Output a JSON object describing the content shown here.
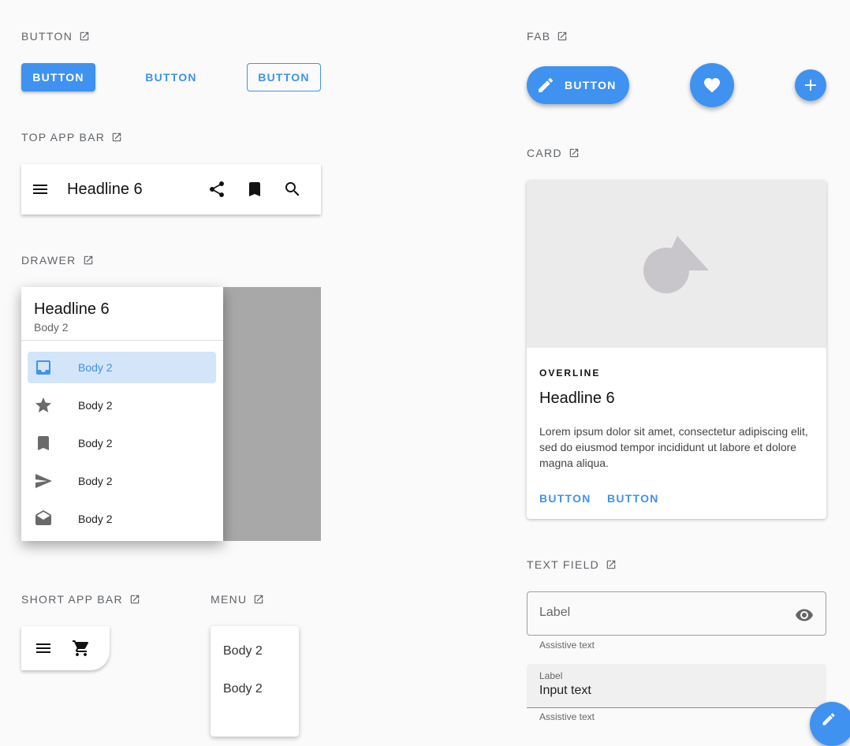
{
  "sections": {
    "button": "BUTTON",
    "top_app_bar": "TOP APP BAR",
    "drawer": "DRAWER",
    "short_app_bar": "SHORT APP BAR",
    "menu": "MENU",
    "fab": "FAB",
    "card": "CARD",
    "text_field": "TEXT FIELD"
  },
  "buttons": {
    "contained": "BUTTON",
    "text": "BUTTON",
    "outlined": "BUTTON"
  },
  "top_app_bar": {
    "title": "Headline 6",
    "icons": [
      "menu-icon",
      "share-icon",
      "bookmark-icon",
      "search-icon"
    ]
  },
  "drawer": {
    "title": "Headline 6",
    "subtitle": "Body 2",
    "items": [
      {
        "label": "Body 2",
        "icon": "inbox-icon",
        "active": true
      },
      {
        "label": "Body 2",
        "icon": "star-icon"
      },
      {
        "label": "Body 2",
        "icon": "bookmark-icon"
      },
      {
        "label": "Body 2",
        "icon": "send-icon"
      },
      {
        "label": "Body 2",
        "icon": "drafts-icon"
      }
    ]
  },
  "short_app_bar": {
    "icons": [
      "menu-icon",
      "cart-icon"
    ]
  },
  "menu": {
    "items": [
      "Body 2",
      "Body 2"
    ]
  },
  "fab": {
    "extended_label": "BUTTON",
    "icons": [
      "edit-icon",
      "heart-icon",
      "add-icon"
    ]
  },
  "card": {
    "overline": "OVERLINE",
    "title": "Headline 6",
    "body": "Lorem ipsum dolor sit amet, consectetur adipiscing elit, sed do eiusmod tempor incididunt ut labore et dolore magna aliqua.",
    "actions": [
      "BUTTON",
      "BUTTON"
    ]
  },
  "text_fields": {
    "outlined": {
      "label": "Label",
      "assistive": "Assistive text"
    },
    "filled": {
      "label": "Label",
      "value": "Input text",
      "assistive": "Assistive text"
    }
  },
  "colors": {
    "primary": "#3f92ef",
    "background": "#fafafa",
    "scrim": "#a8a8a8"
  }
}
